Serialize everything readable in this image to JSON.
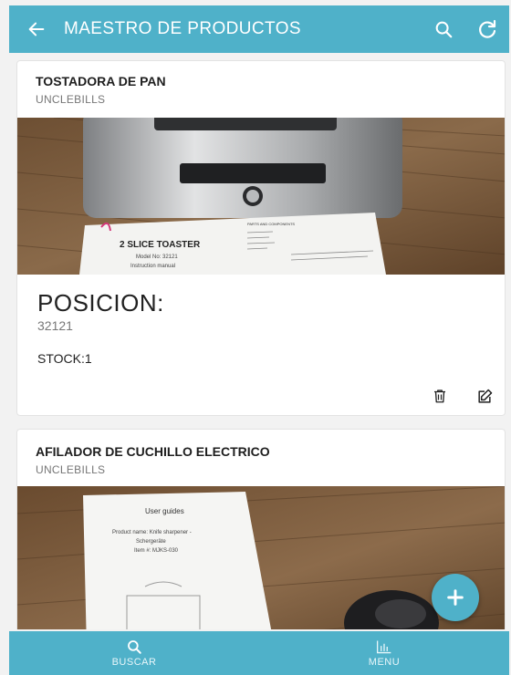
{
  "header": {
    "title": "MAESTRO DE PRODUCTOS",
    "back_icon": "arrow-left-icon",
    "search_icon": "search-icon",
    "refresh_icon": "refresh-icon"
  },
  "products": [
    {
      "name": "TOSTADORA DE PAN",
      "brand": "UNCLEBILLS",
      "position_label": "POSICION:",
      "position_value": "32121",
      "stock": "STOCK:1",
      "photo_text": {
        "manual_title": "2 SLICE TOASTER",
        "manual_model": "Model No: 32121",
        "manual_sub": "Instruction manual",
        "manual_section": "PARTS AND COMPONENTS"
      }
    },
    {
      "name": "AFILADOR DE CUCHILLO ELECTRICO",
      "brand": "UNCLEBILLS",
      "photo_text": {
        "manual_title": "User guides",
        "manual_line1": "Product name: Knife sharpener -",
        "manual_line2": "Schergeräte",
        "manual_line3": "Item #: MJKS-030"
      }
    }
  ],
  "actions": {
    "delete_icon": "trash-icon",
    "edit_icon": "edit-icon",
    "fab_icon": "plus-icon"
  },
  "bottom_nav": [
    {
      "label": "BUSCAR",
      "icon": "search-icon"
    },
    {
      "label": "MENU",
      "icon": "bar-chart-icon"
    }
  ],
  "colors": {
    "primary": "#4fb1c9",
    "background": "#f2f2f2",
    "card": "#ffffff"
  }
}
